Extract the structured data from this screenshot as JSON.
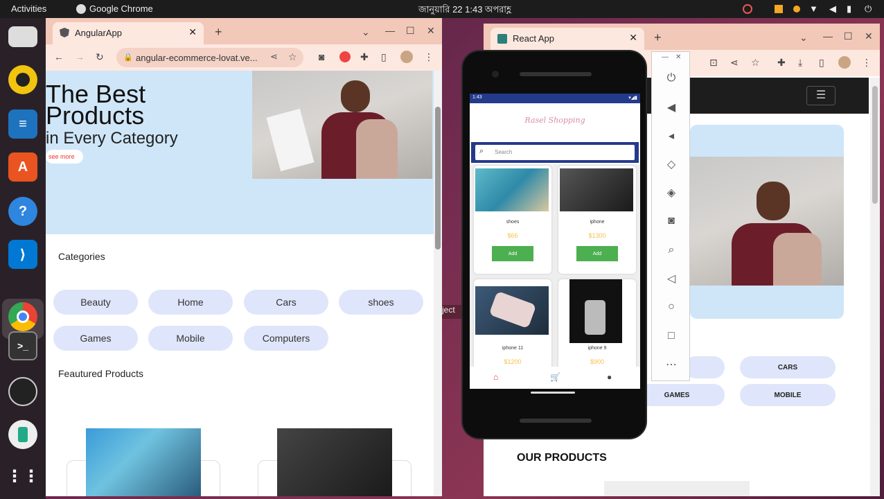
{
  "topbar": {
    "activities": "Activities",
    "app": "Google Chrome",
    "clock": "জানুয়ারি 22  1:43 অপরাহ্ণ"
  },
  "dock": {
    "items": [
      "rhythmbox",
      "writer",
      "software",
      "help",
      "vscode",
      "chrome",
      "terminal",
      "obs",
      "files",
      "apps"
    ]
  },
  "angular": {
    "tab_title": "AngularApp",
    "url": "angular-ecommerce-lovat.ve...",
    "hero_line1": "The Best",
    "hero_line2": "Products",
    "hero_line3": "in Every Category",
    "see_more": "see more",
    "categories_title": "Categories",
    "categories": [
      "Beauty",
      "Home",
      "Cars",
      "shoes",
      "Games",
      "Mobile",
      "Computers"
    ],
    "featured_title": "Feautured Products"
  },
  "react": {
    "tab_title": "React App",
    "categories": [
      "CARS",
      "GAMES",
      "MOBILE"
    ],
    "our_products": "OUR PRODUCTS"
  },
  "phone": {
    "status_time": "1:43",
    "logo": "Rasel Shopping",
    "search_placeholder": "Search",
    "products": [
      {
        "name": "shoes",
        "price": "$66",
        "button": "Add"
      },
      {
        "name": "iphone",
        "price": "$1300",
        "button": "Add"
      },
      {
        "name": "iphone 11",
        "price": "$1200"
      },
      {
        "name": "iphone 9",
        "price": "$900"
      }
    ]
  },
  "emulator": {
    "buttons": [
      "power",
      "volume-up",
      "volume-down",
      "rotate-left",
      "rotate-right",
      "camera",
      "zoom",
      "back",
      "home",
      "overview",
      "more"
    ]
  },
  "misc": {
    "ject_label": "ject"
  }
}
